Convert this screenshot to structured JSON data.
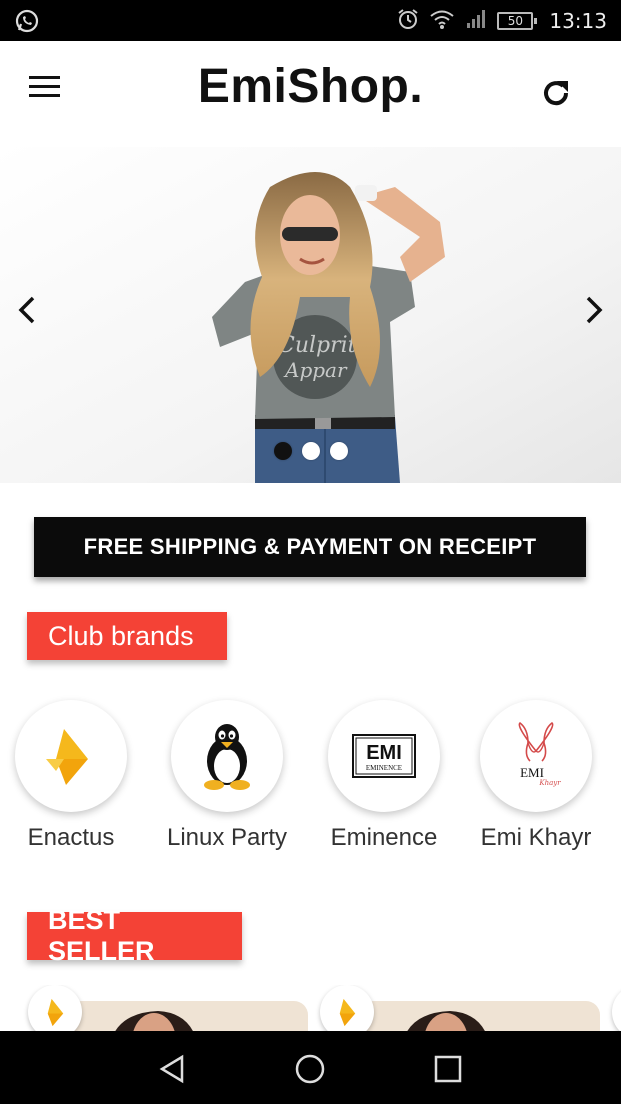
{
  "status_bar": {
    "time": "13:13",
    "battery": "50",
    "left_icon": "whatsapp-icon",
    "right_icons": [
      "alarm-icon",
      "wifi-icon",
      "signal-icon",
      "battery-icon"
    ]
  },
  "app_bar": {
    "title": "EmiShop.",
    "menu_icon": "hamburger-menu-icon",
    "refresh_icon": "refresh-icon"
  },
  "carousel": {
    "slides": 3,
    "active_index": 0,
    "shirt_text_1": "Culprit",
    "shirt_text_2": "Appar"
  },
  "banner": {
    "text": "FREE SHIPPING & PAYMENT ON RECEIPT"
  },
  "club_brands": {
    "title": "Club brands",
    "items": [
      {
        "name": "Enactus",
        "icon": "enactus-logo"
      },
      {
        "name": "Linux Party",
        "icon": "linux-penguin-logo"
      },
      {
        "name": "Eminence",
        "icon": "eminence-logo",
        "logo_text": "EMI",
        "logo_sub": "EMINENCE"
      },
      {
        "name": "Emi Khayr",
        "icon": "emi-khayr-logo",
        "logo_text": "EMI",
        "logo_sub": "Khayr"
      }
    ]
  },
  "best_seller": {
    "title": "BEST SELLER"
  },
  "colors": {
    "accent_red": "#f44236",
    "banner_black": "#0b0b0b",
    "enactus_yellow": "#f5b81c"
  },
  "nav_bar": {
    "buttons": [
      "back-icon",
      "home-icon",
      "recents-icon"
    ]
  }
}
